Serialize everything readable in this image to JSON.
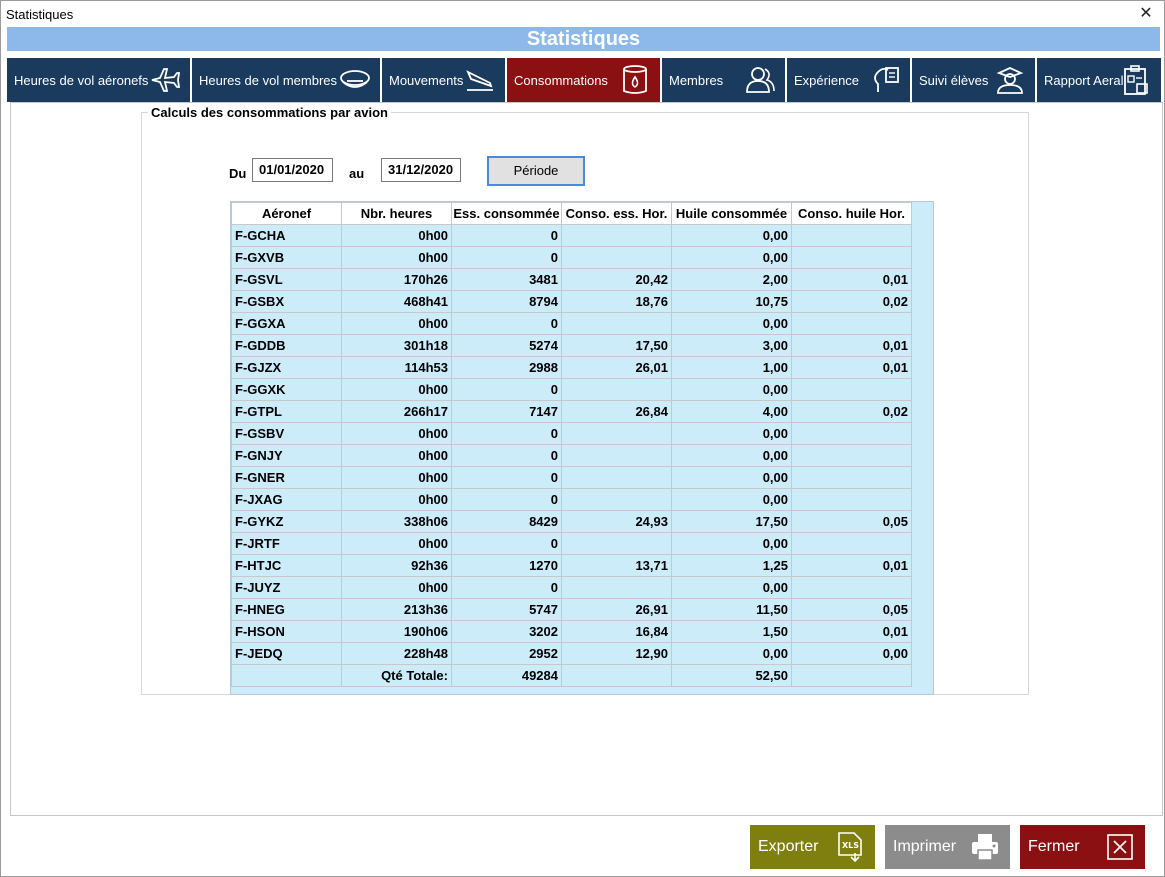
{
  "window": {
    "title": "Statistiques"
  },
  "banner": "Statistiques",
  "tabs": [
    {
      "label": "Heures de vol aéronefs",
      "icon": "airplane-icon"
    },
    {
      "label": "Heures de vol membres",
      "icon": "pilot-cap-icon"
    },
    {
      "label": "Mouvements",
      "icon": "landing-icon"
    },
    {
      "label": "Consommations",
      "icon": "fuel-barrel-icon"
    },
    {
      "label": "Membres",
      "icon": "members-icon"
    },
    {
      "label": "Expérience",
      "icon": "experience-icon"
    },
    {
      "label": "Suivi élèves",
      "icon": "student-icon"
    },
    {
      "label": "Rapport Aeral",
      "icon": "report-icon"
    }
  ],
  "active_tab": "Consommations",
  "group": {
    "title": "Calculs des consommations par avion"
  },
  "period": {
    "from_label": "Du",
    "from_value": "01/01/2020",
    "to_label": "au",
    "to_value": "31/12/2020",
    "button": "Période"
  },
  "table": {
    "headers": [
      "Aéronef",
      "Nbr. heures",
      "Ess. consommée",
      "Conso. ess. Hor.",
      "Huile consommée",
      "Conso. huile Hor."
    ],
    "rows": [
      [
        "F-GCHA",
        "0h00",
        "0",
        "",
        "0,00",
        ""
      ],
      [
        "F-GXVB",
        "0h00",
        "0",
        "",
        "0,00",
        ""
      ],
      [
        "F-GSVL",
        "170h26",
        "3481",
        "20,42",
        "2,00",
        "0,01"
      ],
      [
        "F-GSBX",
        "468h41",
        "8794",
        "18,76",
        "10,75",
        "0,02"
      ],
      [
        "F-GGXA",
        "0h00",
        "0",
        "",
        "0,00",
        ""
      ],
      [
        "F-GDDB",
        "301h18",
        "5274",
        "17,50",
        "3,00",
        "0,01"
      ],
      [
        "F-GJZX",
        "114h53",
        "2988",
        "26,01",
        "1,00",
        "0,01"
      ],
      [
        "F-GGXK",
        "0h00",
        "0",
        "",
        "0,00",
        ""
      ],
      [
        "F-GTPL",
        "266h17",
        "7147",
        "26,84",
        "4,00",
        "0,02"
      ],
      [
        "F-GSBV",
        "0h00",
        "0",
        "",
        "0,00",
        ""
      ],
      [
        "F-GNJY",
        "0h00",
        "0",
        "",
        "0,00",
        ""
      ],
      [
        "F-GNER",
        "0h00",
        "0",
        "",
        "0,00",
        ""
      ],
      [
        "F-JXAG",
        "0h00",
        "0",
        "",
        "0,00",
        ""
      ],
      [
        "F-GYKZ",
        "338h06",
        "8429",
        "24,93",
        "17,50",
        "0,05"
      ],
      [
        "F-JRTF",
        "0h00",
        "0",
        "",
        "0,00",
        ""
      ],
      [
        "F-HTJC",
        "92h36",
        "1270",
        "13,71",
        "1,25",
        "0,01"
      ],
      [
        "F-JUYZ",
        "0h00",
        "0",
        "",
        "0,00",
        ""
      ],
      [
        "F-HNEG",
        "213h36",
        "5747",
        "26,91",
        "11,50",
        "0,05"
      ],
      [
        "F-HSON",
        "190h06",
        "3202",
        "16,84",
        "1,50",
        "0,01"
      ],
      [
        "F-JEDQ",
        "228h48",
        "2952",
        "12,90",
        "0,00",
        "0,00"
      ]
    ],
    "total": [
      "",
      "Qté Totale:",
      "49284",
      "",
      "52,50",
      ""
    ]
  },
  "footer": {
    "export": {
      "label": "Exporter",
      "icon": "xls-export-icon",
      "color": "#7f7f0f"
    },
    "print": {
      "label": "Imprimer",
      "icon": "printer-icon",
      "color": "#8c8c8c"
    },
    "close": {
      "label": "Fermer",
      "icon": "close-box-icon",
      "color": "#8a1012"
    }
  }
}
